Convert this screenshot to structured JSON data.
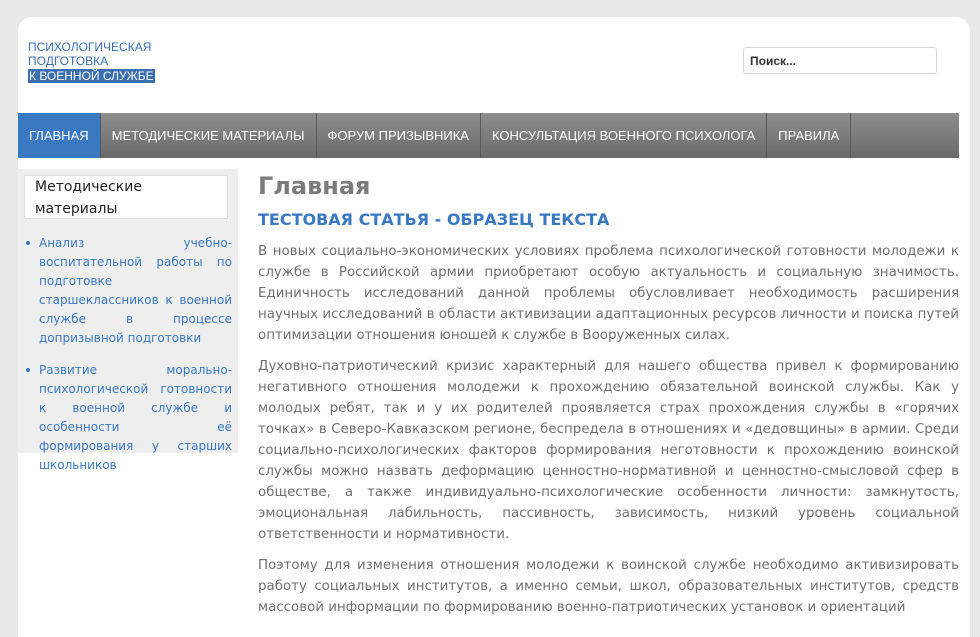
{
  "logo": {
    "line1": "ПСИХОЛОГИЧЕСКАЯ",
    "line2": "ПОДГОТОВКА",
    "line3": "К ВОЕННОЙ СЛУЖБЕ"
  },
  "search": {
    "placeholder": "Поиск..."
  },
  "nav": {
    "items": [
      {
        "label": "ГЛАВНАЯ"
      },
      {
        "label": "МЕТОДИЧЕСКИЕ МАТЕРИАЛЫ"
      },
      {
        "label": "ФОРУМ ПРИЗЫВНИКА"
      },
      {
        "label": "КОНСУЛЬТАЦИЯ ВОЕННОГО ПСИХОЛОГА"
      },
      {
        "label": "ПРАВИЛА"
      }
    ]
  },
  "sidebar": {
    "title": "Методические материалы",
    "items": [
      {
        "label": "Анализ учебно-воспитательной работы по подготовке старшеклассников к военной службе в процессе допризывной подготовки"
      },
      {
        "label": "Развитие морально-психологической готовности к военной службе и особенности её формирования у старших школьников"
      }
    ]
  },
  "main": {
    "page_title": "Главная",
    "article_title": "ТЕСТОВАЯ СТАТЬЯ - ОБРАЗЕЦ ТЕКСТА",
    "paragraphs": [
      "В новых социально-экономических условиях проблема психологической готовности молодежи к службе в Российской армии приобретают особую актуальность и социальную значимость. Единичность исследований данной проблемы обусловливает необходимость расширения научных исследований в области активизации адаптационных ресурсов личности и поиска путей оптимизации отношения юношей к службе в Вооруженных силах.",
      "Духовно-патриотический кризис характерный для нашего общества привел к формированию негативного отношения молодежи к прохождению обязательной воинской службы. Как у молодых ребят, так и у их родителей проявляется страх прохождения службы в «горячих точках» в Северо-Кавказском регионе, беспредела в отношениях и «дедовщины» в армии. Среди социально-психологических факторов формирования неготовности к прохождению воинской службы можно назвать деформацию ценностно-нормативной и ценностно-смысловой сфер в обществе, а также индивидуально-психологические особенности личности: замкнутость, эмоциональная лабильность, пассивность, зависимость, низкий уровень социальной ответственности и нормативности.",
      "Поэтому для изменения отношения молодежи к воинской службе необходимо активизировать работу социальных институтов, а именно семьи, школ, образовательных институтов, средств массовой информации по формированию военно-патриотических установок и ориентаций"
    ]
  }
}
